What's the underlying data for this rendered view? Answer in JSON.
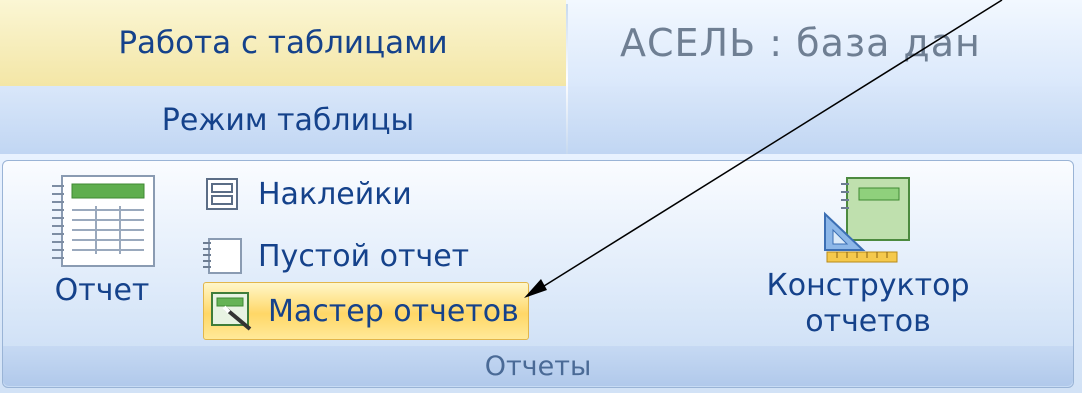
{
  "title_bar": {
    "context_tab_label": "Работа с таблицами",
    "window_title": "АСЕЛЬ : база дан"
  },
  "tabs": {
    "mode_label": "Режим таблицы"
  },
  "ribbon_group": {
    "name": "Отчеты",
    "report_button": {
      "label": "Отчет",
      "icon": "report-icon"
    },
    "labels_button": {
      "label": "Наклейки",
      "icon": "labels-icon"
    },
    "blank_report_button": {
      "label": "Пустой отчет",
      "icon": "blank-report-icon"
    },
    "report_wizard_button": {
      "label": "Мастер отчетов",
      "icon": "report-wizard-icon",
      "state": "hovered"
    },
    "report_designer_button": {
      "label_line1": "Конструктор",
      "label_line2": "отчетов",
      "icon": "report-designer-icon"
    }
  },
  "annotation": {
    "type": "arrow",
    "points_to": "report_wizard_button"
  },
  "colors": {
    "label_text": "#15428b",
    "context_tab": "#f3e6a6",
    "hover_highlight": "#ffd767",
    "group_footer_text": "#4a6a96"
  }
}
